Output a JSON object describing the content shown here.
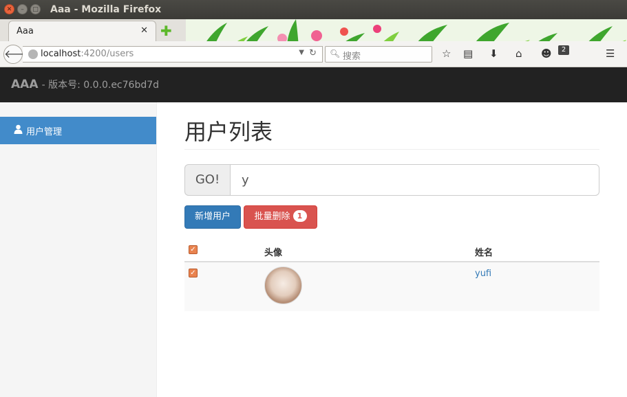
{
  "window": {
    "title": "Aaa - Mozilla Firefox"
  },
  "browser": {
    "tab_label": "Aaa",
    "url_host": "localhost",
    "url_path": ":4200/users",
    "search_placeholder": "搜索",
    "notification_count": "2"
  },
  "app": {
    "brand": "AAA",
    "version_text": "- 版本号: 0.0.0.ec76bd7d"
  },
  "sidebar": {
    "items": [
      {
        "label": "用户管理",
        "icon": "user-icon",
        "active": true
      }
    ]
  },
  "main": {
    "title": "用户列表",
    "search": {
      "addon_label": "GO!",
      "value": "y"
    },
    "buttons": {
      "add_label": "新增用户",
      "batch_delete_label": "批量删除",
      "batch_delete_count": "1"
    },
    "table": {
      "headers": {
        "avatar": "头像",
        "name": "姓名"
      },
      "rows": [
        {
          "checked": true,
          "name": "yufi"
        }
      ]
    }
  },
  "colors": {
    "header_bg": "#222222",
    "sidebar_active": "#428bca",
    "primary": "#337ab7",
    "danger": "#d9534f",
    "checkbox": "#e9834f"
  }
}
